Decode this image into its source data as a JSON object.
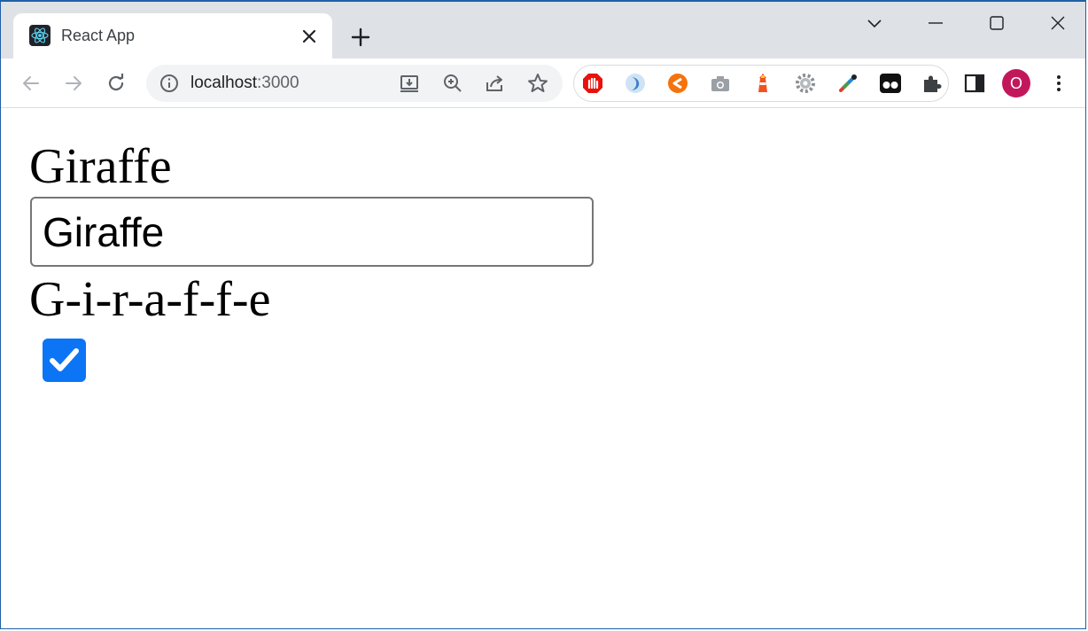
{
  "browser": {
    "tab": {
      "title": "React App",
      "favicon": "react-logo-icon"
    },
    "toolbar": {
      "url_host": "localhost",
      "url_port": ":3000",
      "avatar_initial": "O"
    },
    "extensions": [
      "adblock-icon",
      "vpn-icon",
      "orange-arrow-icon",
      "camera-icon",
      "lighthouse-icon",
      "gear-icon",
      "eyedropper-icon",
      "glasses-icon"
    ]
  },
  "page": {
    "heading": "Giraffe",
    "input": {
      "value": "Giraffe"
    },
    "spelled_out": "G-i-r-a-f-f-e",
    "checkbox_checked": true,
    "accent_color": "#0b75f5"
  }
}
